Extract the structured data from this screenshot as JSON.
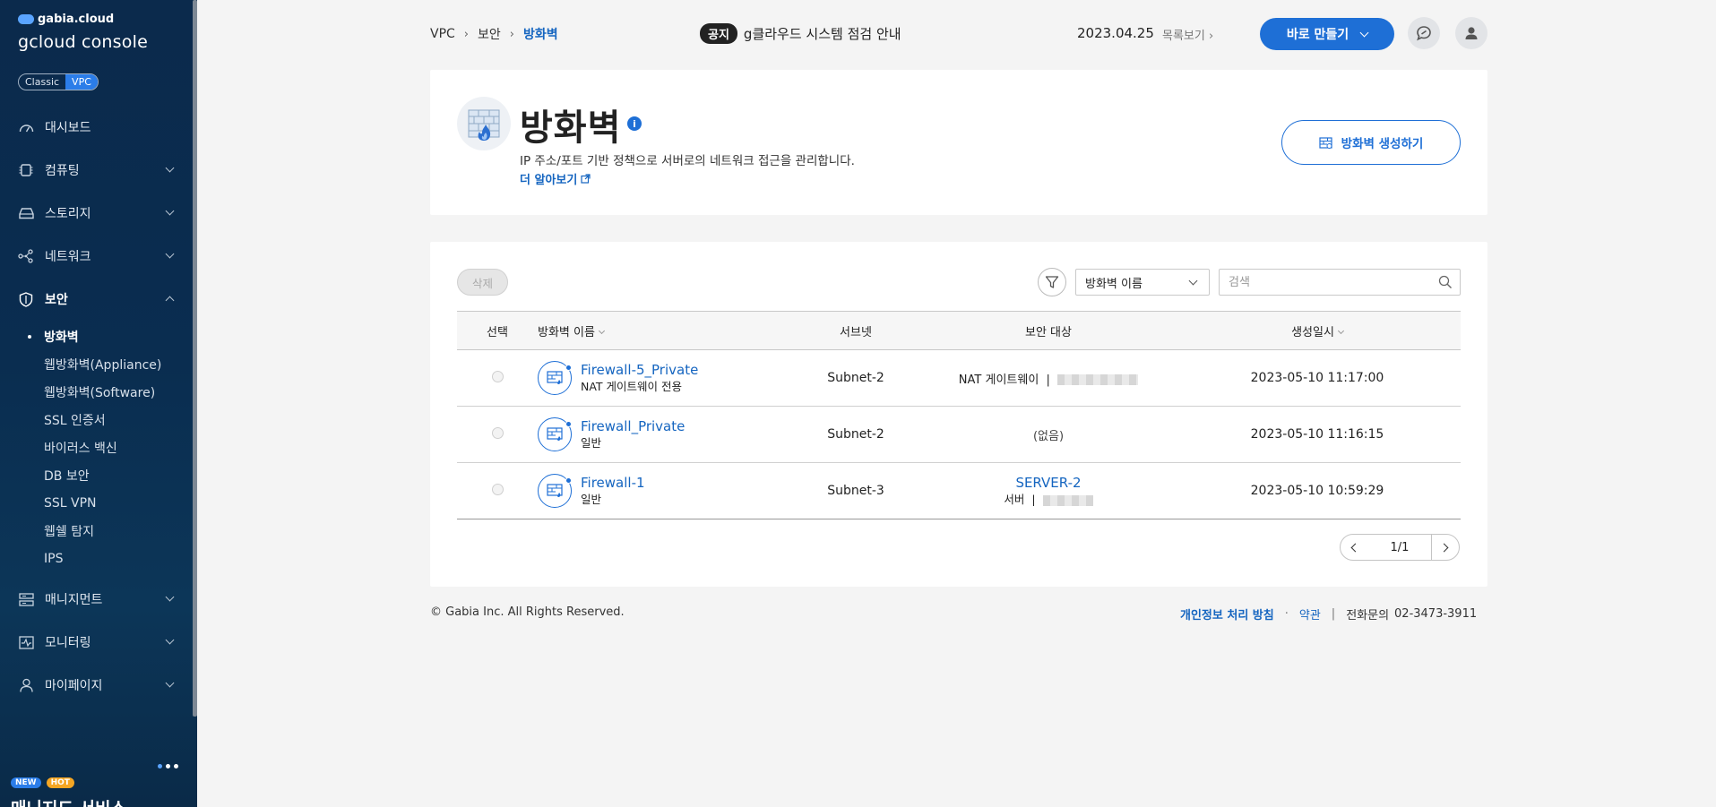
{
  "sidebar": {
    "logo_small": "gabia.cloud",
    "logo_big": "gcloud console",
    "toggle": {
      "classic": "Classic",
      "vpc": "VPC"
    },
    "menu": [
      {
        "label": "대시보드",
        "icon": "dashboard-icon"
      },
      {
        "label": "컴퓨팅",
        "icon": "chip-icon"
      },
      {
        "label": "스토리지",
        "icon": "storage-icon"
      },
      {
        "label": "네트워크",
        "icon": "network-icon"
      },
      {
        "label": "보안",
        "icon": "shield-icon"
      }
    ],
    "security_sub": [
      {
        "label": "방화벽"
      },
      {
        "label": "웹방화벽(Appliance)"
      },
      {
        "label": "웹방화벽(Software)"
      },
      {
        "label": "SSL 인증서"
      },
      {
        "label": "바이러스 백신"
      },
      {
        "label": "DB 보안"
      },
      {
        "label": "SSL VPN"
      },
      {
        "label": "웹쉘 탐지"
      },
      {
        "label": "IPS"
      }
    ],
    "menu_lower": [
      {
        "label": "매니지먼트",
        "icon": "management-icon"
      },
      {
        "label": "모니터링",
        "icon": "monitoring-icon"
      },
      {
        "label": "마이페이지",
        "icon": "user-icon"
      }
    ],
    "badges": {
      "new": "NEW",
      "hot": "HOT"
    },
    "managed_service": "매니지드 서비스"
  },
  "header": {
    "breadcrumb": [
      "VPC",
      "보안",
      "방화벽"
    ],
    "notice_tag": "공지",
    "notice_text": "g클라우드 시스템 점검 안내",
    "notice_date": "2023.04.25",
    "notice_list": "목록보기",
    "create_button": "바로 만들기"
  },
  "title_card": {
    "title": "방화벽",
    "info": "i",
    "description": "IP 주소/포트 기반 정책으로 서버로의 네트워크 접근을 관리합니다.",
    "more_link": "더 알아보기",
    "create_firewall_button": "방화벽 생성하기"
  },
  "table_card": {
    "delete_button": "삭제",
    "filter_select": "방화벽 이름",
    "search_placeholder": "검색",
    "columns": {
      "select": "선택",
      "name": "방화벽 이름",
      "subnet": "서브넷",
      "target": "보안 대상",
      "created": "생성일시"
    },
    "rows": [
      {
        "name": "Firewall-5_Private",
        "type": "NAT 게이트웨이 전용",
        "subnet": "Subnet-2",
        "target_label": "NAT 게이트웨이",
        "target_sep": "|",
        "created": "2023-05-10 11:17:00"
      },
      {
        "name": "Firewall_Private",
        "type": "일반",
        "subnet": "Subnet-2",
        "target_none": "(없음)",
        "created": "2023-05-10 11:16:15"
      },
      {
        "name": "Firewall-1",
        "type": "일반",
        "subnet": "Subnet-3",
        "target_link": "SERVER-2",
        "target_sub_label": "서버",
        "target_sep": "|",
        "created": "2023-05-10 10:59:29"
      }
    ],
    "pagination": "1/1"
  },
  "footer": {
    "copyright": "© Gabia Inc. All Rights Reserved.",
    "privacy": "개인정보 처리 방침",
    "dot": "·",
    "terms": "약관",
    "bar": "|",
    "phone_label": "전화문의",
    "phone": "02-3473-3911"
  }
}
